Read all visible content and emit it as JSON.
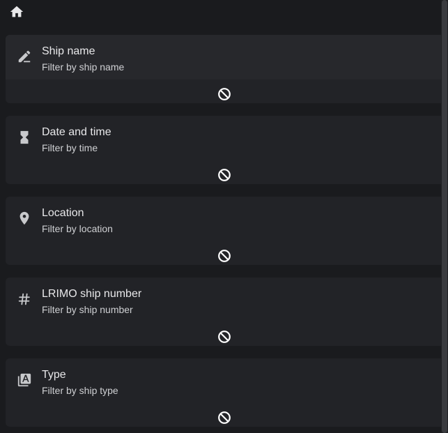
{
  "topbar": {
    "home_icon": "home-icon"
  },
  "filters": [
    {
      "icon": "pencil-icon",
      "title": "Ship name",
      "subtitle": "Filter by ship name",
      "clear_icon": "block-icon"
    },
    {
      "icon": "hourglass-icon",
      "title": "Date and time",
      "subtitle": "Filter by time",
      "clear_icon": "block-icon"
    },
    {
      "icon": "location-pin-icon",
      "title": "Location",
      "subtitle": "Filter by location",
      "clear_icon": "block-icon"
    },
    {
      "icon": "hash-icon",
      "title": "LRIMO ship number",
      "subtitle": "Filter by ship number",
      "clear_icon": "block-icon"
    },
    {
      "icon": "type-library-icon",
      "title": "Type",
      "subtitle": "Filter by ship type",
      "clear_icon": "block-icon"
    }
  ],
  "colors": {
    "background": "#1a1b1e",
    "card": "#222327",
    "card_active_header": "#27282c",
    "text_primary": "#e8e8ea",
    "text_secondary": "#cfd0d3",
    "icon": "#c8c9cc"
  }
}
